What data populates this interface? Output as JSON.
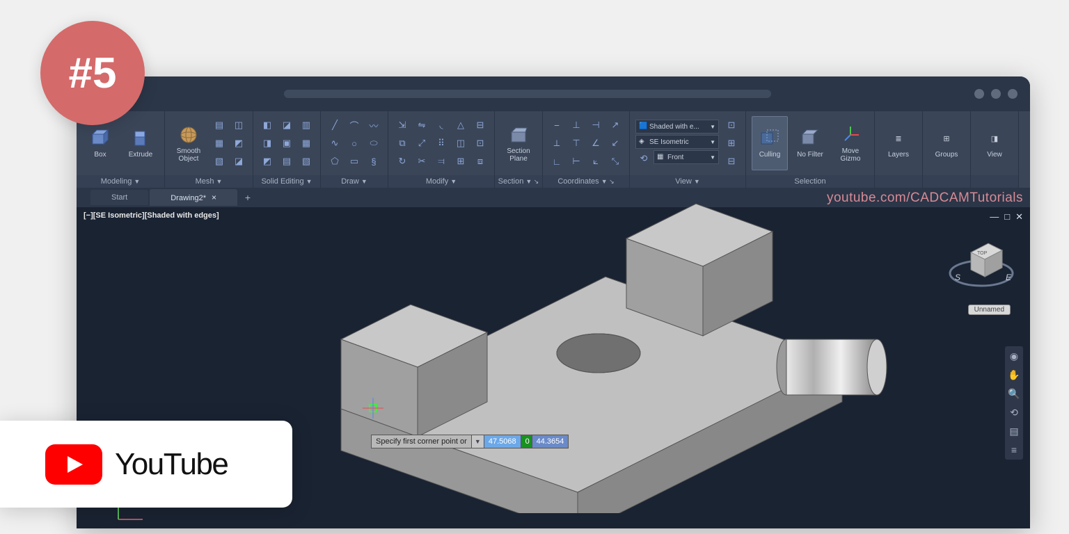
{
  "badge": {
    "text": "#5"
  },
  "youtube": {
    "label": "YouTube"
  },
  "watermark": "youtube.com/CADCAMTutorials",
  "ribbon": {
    "modeling": {
      "label": "Modeling",
      "box": "Box",
      "extrude": "Extrude"
    },
    "mesh": {
      "label": "Mesh",
      "smooth": "Smooth\nObject"
    },
    "solid_editing": {
      "label": "Solid Editing"
    },
    "draw": {
      "label": "Draw"
    },
    "modify": {
      "label": "Modify"
    },
    "section": {
      "label": "Section",
      "plane": "Section\nPlane"
    },
    "coordinates": {
      "label": "Coordinates"
    },
    "view": {
      "label": "View",
      "shaded": "Shaded with e...",
      "iso": "SE Isometric",
      "front": "Front"
    },
    "selection": {
      "label": "Selection",
      "culling": "Culling",
      "nofilter": "No Filter",
      "gizmo": "Move\nGizmo"
    },
    "layers": {
      "label": "Layers"
    },
    "groups": {
      "label": "Groups"
    },
    "viewtab": {
      "label": "View"
    }
  },
  "tabs": {
    "start": "Start",
    "drawing": "Drawing2*"
  },
  "viewport": {
    "label": "[−][SE Isometric][Shaded with edges]",
    "unnamed": "Unnamed"
  },
  "dynamic_input": {
    "prompt": "Specify first corner point or",
    "v1": "47.5068",
    "v2": "0",
    "v3": "44.3654"
  }
}
